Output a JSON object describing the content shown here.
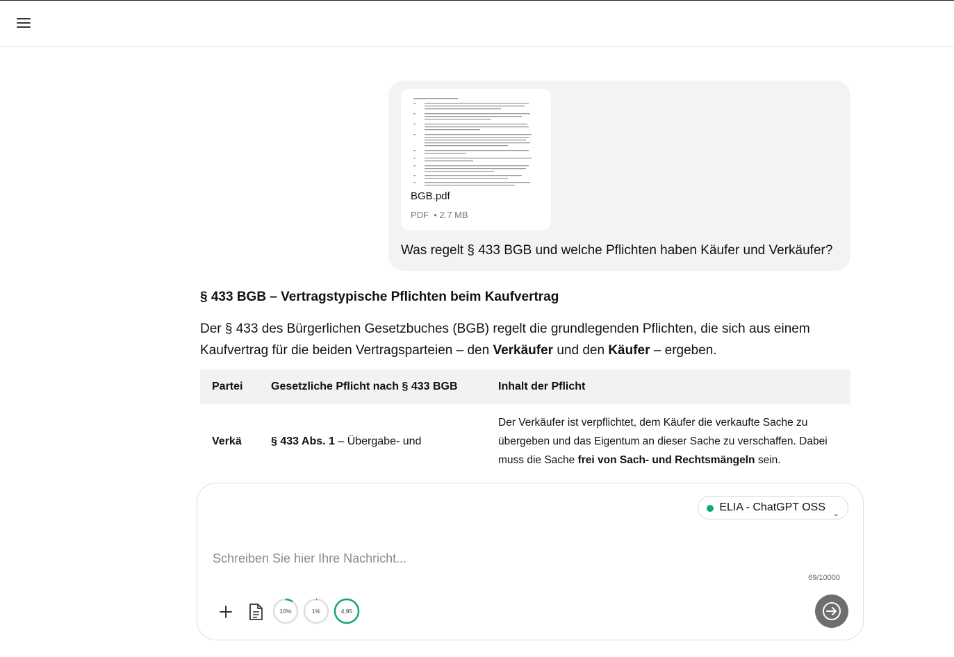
{
  "header": {
    "menu_icon": "hamburger-menu-icon"
  },
  "user_message": {
    "attachment": {
      "name": "BGB.pdf",
      "type": "PDF",
      "size": "2.7 MB"
    },
    "text": "Was regelt § 433 BGB und welche Pflichten haben Käufer und Verkäufer?"
  },
  "answer": {
    "heading": "§ 433 BGB – Vertragstypische Pflichten beim Kaufvertrag",
    "intro_1": "Der § 433 des Bürgerlichen Gesetzbuches (BGB) regelt die grundlegenden Pflichten, die sich aus einem Kaufvertrag für die beiden Vertragsparteien – den ",
    "intro_seller": "Verkäufer",
    "intro_2": " und den ",
    "intro_buyer": "Käufer",
    "intro_3": " – ergeben.",
    "table": {
      "headers": [
        "Partei",
        "Gesetzliche Pflicht nach § 433 BGB",
        "Inhalt der Pflicht"
      ],
      "rows": [
        {
          "party": "Verkä",
          "duty_bold": "§ 433 Abs. 1",
          "duty_rest": " – Übergabe- und",
          "content_1": "Der Verkäufer ist verpflichtet, dem Käufer die verkaufte Sache zu übergeben und das Eigentum an dieser Sache zu verschaffen. Dabei muss die Sache ",
          "content_bold": "frei von Sach- und Rechtsmängeln",
          "content_2": " sein."
        }
      ]
    }
  },
  "composer": {
    "model_label": "ELIA - ChatGPT OSS",
    "model_status_color": "#12a37f",
    "placeholder": "Schreiben Sie hier Ihre Nachricht...",
    "counter": "69/10000",
    "gauges": [
      {
        "label": "10%",
        "fraction": 0.1,
        "color": "#12a37f"
      },
      {
        "label": "1%",
        "fraction": 0.01,
        "color": "#12a37f"
      },
      {
        "label": "4,95",
        "fraction": 1.0,
        "color": "#12a37f"
      }
    ],
    "send_icon": "arrow-right-icon"
  }
}
